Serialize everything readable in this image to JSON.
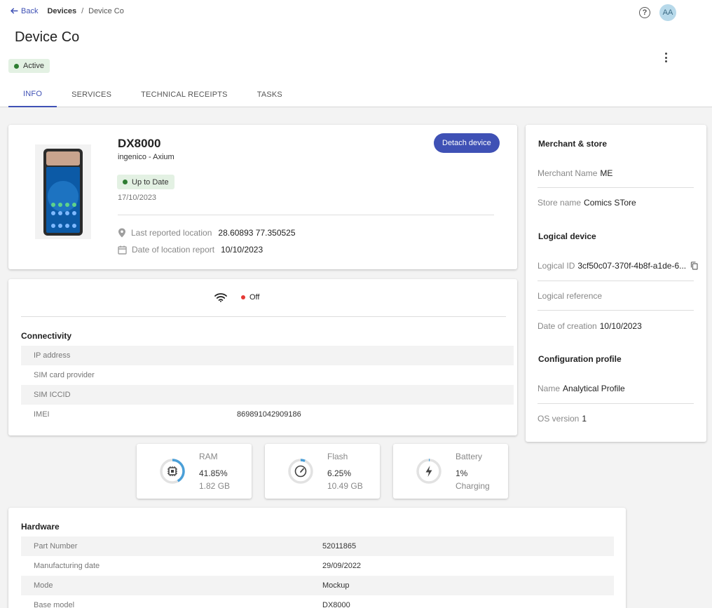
{
  "header": {
    "back_label": "Back",
    "breadcrumb_root": "Devices",
    "breadcrumb_sep": "/",
    "breadcrumb_current": "Device Co",
    "help_label": "?",
    "avatar_initials": "AA",
    "title": "Device Co",
    "status": "Active",
    "status_color": "#2e7d32"
  },
  "tabs": [
    "INFO",
    "SERVICES",
    "TECHNICAL RECEIPTS",
    "TASKS"
  ],
  "device": {
    "model": "DX8000",
    "brand": "ingenico - Axium",
    "update_status": "Up to Date",
    "update_date": "17/10/2023",
    "detach_label": "Detach device",
    "location_label": "Last reported location",
    "location_value": "28.60893 77.350525",
    "location_date_label": "Date of location report",
    "location_date_value": "10/10/2023"
  },
  "connectivity": {
    "wifi_status": "Off",
    "title": "Connectivity",
    "rows": [
      {
        "label": "IP address",
        "value": ""
      },
      {
        "label": "SIM card provider",
        "value": ""
      },
      {
        "label": "SIM ICCID",
        "value": ""
      },
      {
        "label": "IMEI",
        "value": "869891042909186"
      }
    ]
  },
  "stats": [
    {
      "title": "RAM",
      "value": "41.85%",
      "sub": "1.82 GB",
      "fraction": 0.4185,
      "icon": "chip-icon"
    },
    {
      "title": "Flash",
      "value": "6.25%",
      "sub": "10.49 GB",
      "fraction": 0.0625,
      "icon": "gauge-icon"
    },
    {
      "title": "Battery",
      "value": "1%",
      "sub": "Charging",
      "fraction": 0.01,
      "icon": "bolt-icon"
    }
  ],
  "hardware": {
    "title": "Hardware",
    "rows": [
      {
        "label": "Part Number",
        "value": "52011865"
      },
      {
        "label": "Manufacturing date",
        "value": "29/09/2022"
      },
      {
        "label": "Mode",
        "value": "Mockup"
      },
      {
        "label": "Base model",
        "value": "DX8000"
      }
    ]
  },
  "side": {
    "merchant_title": "Merchant & store",
    "merchant_name_label": "Merchant Name",
    "merchant_name_value": "ME",
    "store_name_label": "Store name",
    "store_name_value": "Comics STore",
    "logical_title": "Logical device",
    "logical_id_label": "Logical ID",
    "logical_id_value": "3cf50c07-370f-4b8f-a1de-6...",
    "logical_ref_label": "Logical reference",
    "creation_label": "Date of creation",
    "creation_value": "10/10/2023",
    "config_title": "Configuration profile",
    "name_label": "Name",
    "name_value": "Analytical Profile",
    "os_label": "OS version",
    "os_value": "1"
  },
  "colors": {
    "accent": "#3f51b5",
    "ring": "#4a9fd8",
    "offline": "#e53935"
  }
}
